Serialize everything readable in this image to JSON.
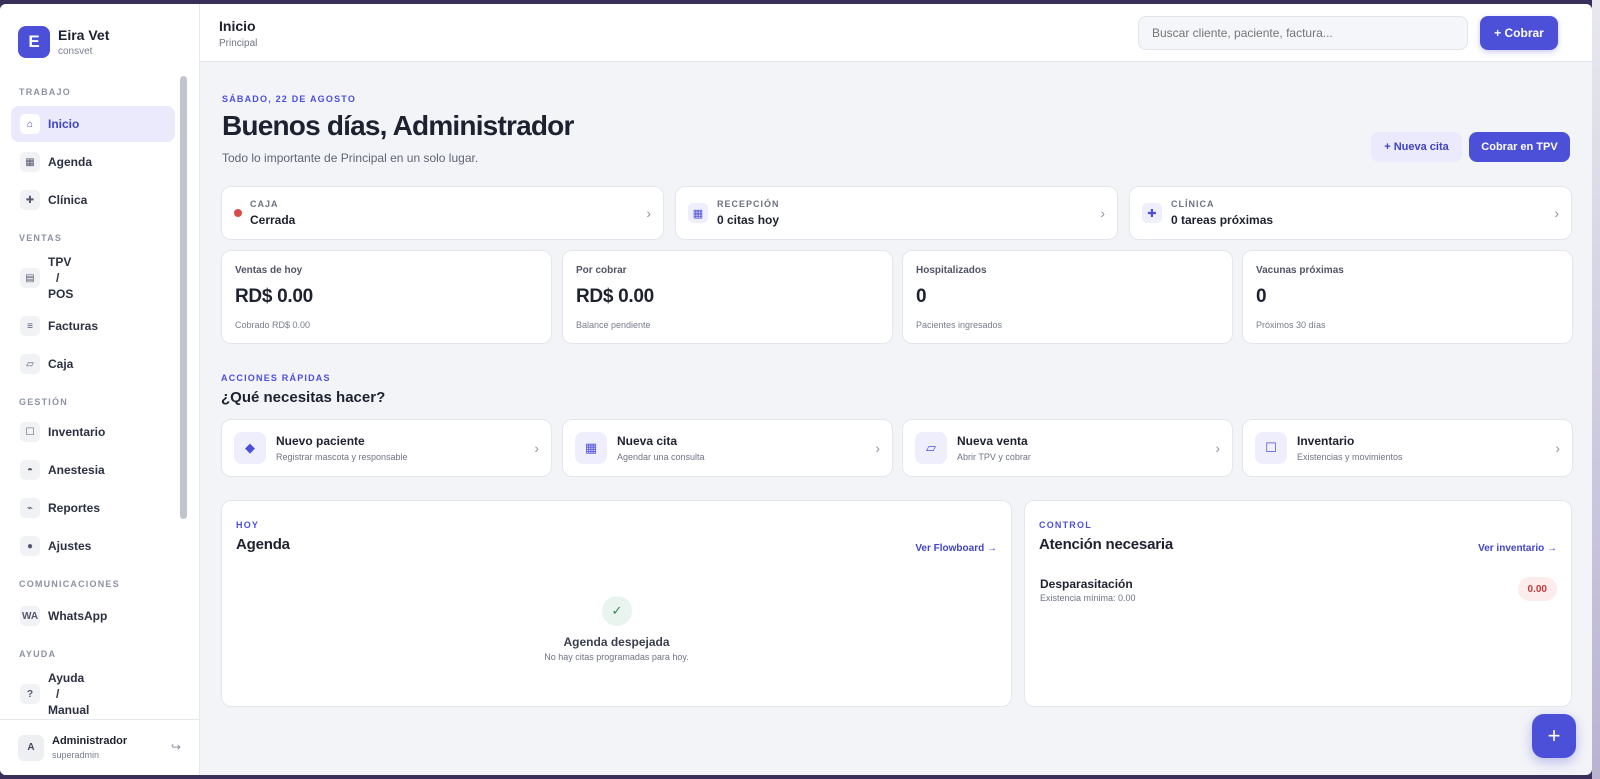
{
  "app": {
    "name": "Eira Vet",
    "subtitle": "consvet",
    "logo_letter": "E",
    "accent": "#4c4fd8"
  },
  "sidebar": {
    "sections": [
      {
        "title": "TRABAJO",
        "items": [
          {
            "label": "Inicio",
            "icon": "home-icon",
            "glyph": "⌂",
            "active": true
          },
          {
            "label": "Agenda",
            "icon": "calendar-icon",
            "glyph": "▦"
          },
          {
            "label": "Clínica",
            "icon": "plus-cross-icon",
            "glyph": "✚"
          }
        ]
      },
      {
        "title": "VENTAS",
        "items": [
          {
            "label_lines": [
              "TPV",
              "/",
              "POS"
            ],
            "icon": "register-icon",
            "glyph": "▤"
          },
          {
            "label": "Facturas",
            "icon": "list-icon",
            "glyph": "≡"
          },
          {
            "label": "Caja",
            "icon": "cash-box-icon",
            "glyph": "▱"
          }
        ]
      },
      {
        "title": "GESTIÓN",
        "items": [
          {
            "label": "Inventario",
            "icon": "box-icon",
            "glyph": "☐"
          },
          {
            "label": "Anestesia",
            "icon": "gauge-icon",
            "glyph": "◓"
          },
          {
            "label": "Reportes",
            "icon": "trend-icon",
            "glyph": "⌁"
          },
          {
            "label": "Ajustes",
            "icon": "gear-icon",
            "glyph": "●"
          }
        ]
      },
      {
        "title": "COMUNICACIONES",
        "items": [
          {
            "label": "WhatsApp",
            "icon": "whatsapp-icon",
            "glyph": "WA"
          }
        ]
      },
      {
        "title": "AYUDA",
        "items": [
          {
            "label_lines": [
              "Ayuda",
              "/",
              "Manual"
            ],
            "icon": "help-icon",
            "glyph": "?"
          }
        ]
      }
    ],
    "user": {
      "initial": "A",
      "name": "Administrador",
      "role": "superadmin",
      "logout_glyph": "↪"
    }
  },
  "topbar": {
    "title": "Inicio",
    "subtitle": "Principal",
    "search_placeholder": "Buscar cliente, paciente, factura...",
    "cobrar_label": "+ Cobrar"
  },
  "hero": {
    "date": "SÁBADO, 22 DE AGOSTO",
    "greeting": "Buenos días, Administrador",
    "subtitle": "Todo lo importante de Principal en un solo lugar.",
    "nueva_cita_label": "+ Nueva cita",
    "cobrar_tpv_label": "Cobrar en TPV"
  },
  "status_cards": [
    {
      "label": "CAJA",
      "value": "Cerrada",
      "icon": "red-dot-icon",
      "status_color": "#d94c4c"
    },
    {
      "label": "RECEPCIÓN",
      "value": "0 citas hoy",
      "icon": "calendar-icon",
      "glyph": "▦"
    },
    {
      "label": "CLÍNICA",
      "value": "0 tareas próximas",
      "icon": "plus-cross-icon",
      "glyph": "✚"
    }
  ],
  "kpis": [
    {
      "label": "Ventas de hoy",
      "value": "RD$ 0.00",
      "sub": "Cobrado RD$ 0.00"
    },
    {
      "label": "Por cobrar",
      "value": "RD$ 0.00",
      "sub": "Balance pendiente"
    },
    {
      "label": "Hospitalizados",
      "value": "0",
      "sub": "Pacientes ingresados"
    },
    {
      "label": "Vacunas próximas",
      "value": "0",
      "sub": "Próximos 30 días"
    }
  ],
  "quick_actions": {
    "kicker": "ACCIONES RÁPIDAS",
    "title": "¿Qué necesitas hacer?",
    "items": [
      {
        "name": "Nuevo paciente",
        "desc": "Registrar mascota y responsable",
        "icon": "paw-diamond-icon",
        "glyph": "◆"
      },
      {
        "name": "Nueva cita",
        "desc": "Agendar una consulta",
        "icon": "calendar-icon",
        "glyph": "▦"
      },
      {
        "name": "Nueva venta",
        "desc": "Abrir TPV y cobrar",
        "icon": "register-icon",
        "glyph": "▱"
      },
      {
        "name": "Inventario",
        "desc": "Existencias y movimientos",
        "icon": "box-icon",
        "glyph": "☐"
      }
    ]
  },
  "agenda_panel": {
    "kicker": "HOY",
    "title": "Agenda",
    "link": "Ver Flowboard →",
    "empty_title": "Agenda despejada",
    "empty_sub": "No hay citas programadas para hoy.",
    "check_glyph": "✓"
  },
  "control_panel": {
    "kicker": "CONTROL",
    "title": "Atención necesaria",
    "link": "Ver inventario →",
    "alert": {
      "name": "Desparasitación",
      "sub": "Existencia mínima: 0.00",
      "badge": "0.00"
    }
  },
  "fab_glyph": "+"
}
